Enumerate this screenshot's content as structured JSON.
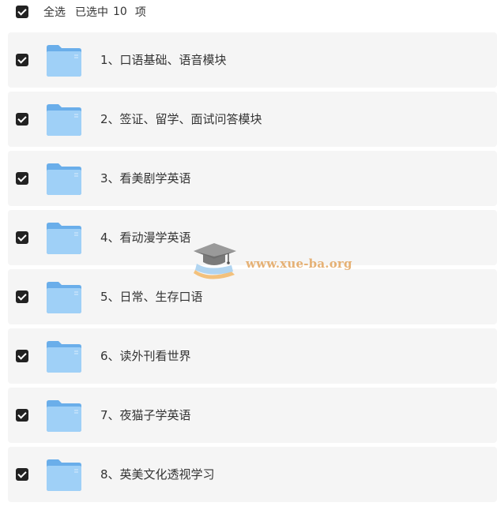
{
  "header": {
    "select_all_label": "全选",
    "selected_prefix": "已选中",
    "selected_count": "10",
    "selected_suffix": "项"
  },
  "items": [
    {
      "name": "1、口语基础、语音模块",
      "checked": true,
      "icon": "folder-icon"
    },
    {
      "name": "2、签证、留学、面试问答模块",
      "checked": true,
      "icon": "folder-icon"
    },
    {
      "name": "3、看美剧学英语",
      "checked": true,
      "icon": "folder-icon"
    },
    {
      "name": "4、看动漫学英语",
      "checked": true,
      "icon": "folder-icon"
    },
    {
      "name": "5、日常、生存口语",
      "checked": true,
      "icon": "folder-icon"
    },
    {
      "name": "6、读外刊看世界",
      "checked": true,
      "icon": "folder-icon"
    },
    {
      "name": "7、夜猫子学英语",
      "checked": true,
      "icon": "folder-icon"
    },
    {
      "name": "8、英美文化透视学习",
      "checked": true,
      "icon": "folder-icon"
    }
  ],
  "watermark": {
    "text": "www.xue-ba.org",
    "icon": "graduation-cap-icon"
  },
  "colors": {
    "checkbox": "#222222",
    "row_background": "#f5f5f5",
    "folder_front": "#9fd0f7",
    "folder_back": "#6aaeea",
    "watermark_text": "#e3a55e"
  }
}
